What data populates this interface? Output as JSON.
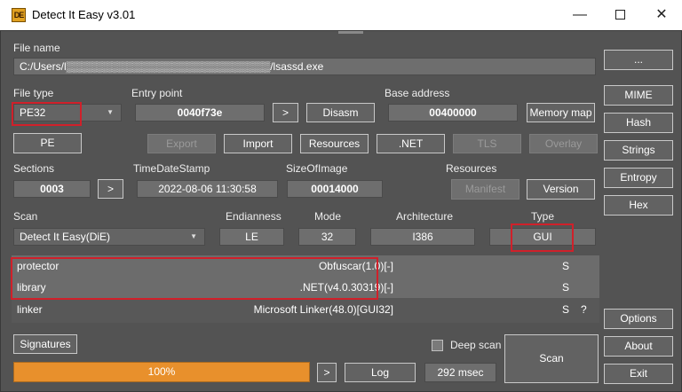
{
  "window": {
    "app_icon_text": "DE",
    "title": "Detect It Easy v3.01",
    "minimize_glyph": "—",
    "close_glyph": "✕"
  },
  "file": {
    "label": "File name",
    "path": "C:/Users/l▒▒▒▒▒▒▒▒▒▒▒▒▒▒▒▒▒▒▒▒▒▒▒▒▒▒▒/lsassd.exe",
    "browse_label": "..."
  },
  "file_type": {
    "label": "File type",
    "value": "PE32"
  },
  "entry_point": {
    "label": "Entry point",
    "value": "0040f73e",
    "go_label": ">",
    "disasm_label": "Disasm"
  },
  "base_address": {
    "label": "Base address",
    "value": "00400000",
    "memory_map_label": "Memory map"
  },
  "buttons_row": {
    "pe": "PE",
    "export": "Export",
    "import": "Import",
    "resources": "Resources",
    "net": ".NET",
    "tls": "TLS",
    "overlay": "Overlay"
  },
  "sections": {
    "label": "Sections",
    "value": "0003",
    "go_label": ">"
  },
  "timestamp": {
    "label": "TimeDateStamp",
    "value": "2022-08-06 11:30:58"
  },
  "size_of_image": {
    "label": "SizeOfImage",
    "value": "00014000"
  },
  "resources": {
    "label": "Resources",
    "manifest_label": "Manifest",
    "version_label": "Version"
  },
  "scan": {
    "label": "Scan",
    "engine": "Detect It Easy(DiE)",
    "endianness_label": "Endianness",
    "endianness": "LE",
    "mode_label": "Mode",
    "mode": "32",
    "arch_label": "Architecture",
    "arch": "I386",
    "type_label": "Type",
    "type": "GUI"
  },
  "results": [
    {
      "kind": "protector",
      "name": "Obfuscar(1.0)[-]",
      "flag": "S",
      "extra": ""
    },
    {
      "kind": "library",
      "name": ".NET(v4.0.30319)[-]",
      "flag": "S",
      "extra": ""
    },
    {
      "kind": "linker",
      "name": "Microsoft Linker(48.0)[GUI32]",
      "flag": "S",
      "extra": "?"
    }
  ],
  "bottom": {
    "signatures_label": "Signatures",
    "deep_scan_label": "Deep scan",
    "deep_scan_checked": false,
    "scan_label": "Scan",
    "progress_text": "100%",
    "progress_value": 1.0,
    "go_label": ">",
    "log_label": "Log",
    "elapsed": "292 msec"
  },
  "sidebar": {
    "mime": "MIME",
    "hash": "Hash",
    "strings": "Strings",
    "entropy": "Entropy",
    "hex": "Hex",
    "options": "Options",
    "about": "About",
    "exit": "Exit"
  },
  "colors": {
    "panel_bg": "#535353",
    "highlight_red": "#d0202a",
    "progress_orange": "#e8902c"
  }
}
